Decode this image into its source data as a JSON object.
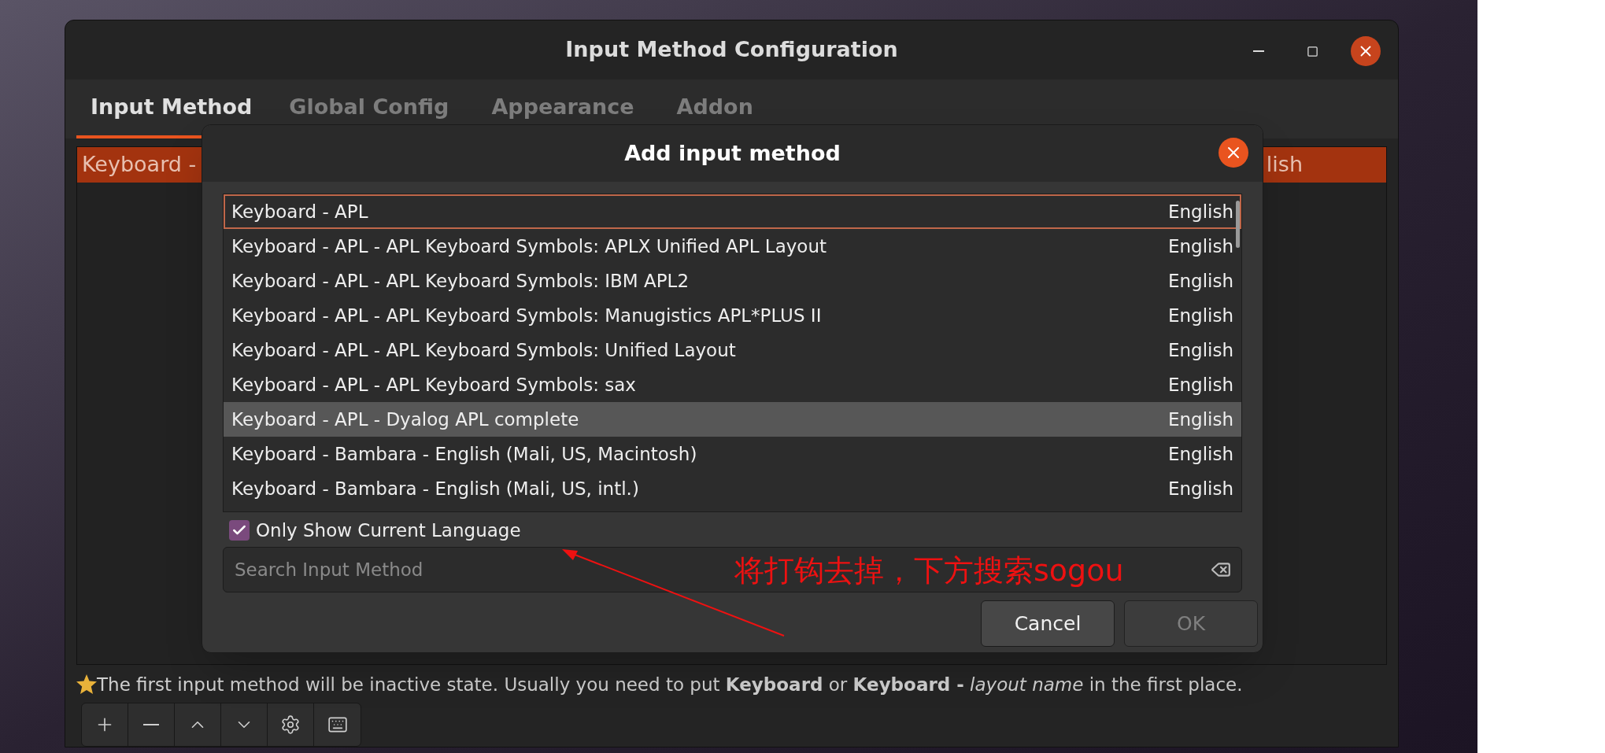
{
  "window": {
    "title": "Input Method Configuration"
  },
  "tabs": [
    {
      "label": "Input Method",
      "selected": true
    },
    {
      "label": "Global Config",
      "selected": false
    },
    {
      "label": "Appearance",
      "selected": false
    },
    {
      "label": "Addon",
      "selected": false
    }
  ],
  "current_list": {
    "rows": [
      {
        "name": "Keyboard -",
        "language": "lish",
        "selected": true
      }
    ]
  },
  "dialog": {
    "title": "Add input method",
    "rows": [
      {
        "name": "Keyboard - APL",
        "language": "English",
        "selected": true,
        "highlighted": false
      },
      {
        "name": "Keyboard - APL - APL Keyboard Symbols: APLX Unified APL Layout",
        "language": "English",
        "selected": false,
        "highlighted": false
      },
      {
        "name": "Keyboard - APL - APL Keyboard Symbols: IBM APL2",
        "language": "English",
        "selected": false,
        "highlighted": false
      },
      {
        "name": "Keyboard - APL - APL Keyboard Symbols: Manugistics APL*PLUS II",
        "language": "English",
        "selected": false,
        "highlighted": false
      },
      {
        "name": "Keyboard - APL - APL Keyboard Symbols: Unified Layout",
        "language": "English",
        "selected": false,
        "highlighted": false
      },
      {
        "name": "Keyboard - APL - APL Keyboard Symbols: sax",
        "language": "English",
        "selected": false,
        "highlighted": false
      },
      {
        "name": "Keyboard - APL - Dyalog APL complete",
        "language": "English",
        "selected": false,
        "highlighted": true
      },
      {
        "name": "Keyboard - Bambara - English (Mali, US, Macintosh)",
        "language": "English",
        "selected": false,
        "highlighted": false
      },
      {
        "name": "Keyboard - Bambara - English (Mali, US, intl.)",
        "language": "English",
        "selected": false,
        "highlighted": false
      }
    ],
    "only_current_language": {
      "label": "Only Show Current Language",
      "checked": true
    },
    "search": {
      "placeholder": "Search Input Method"
    },
    "buttons": [
      {
        "label": "Cancel",
        "disabled": false
      },
      {
        "label": "OK",
        "disabled": true
      }
    ]
  },
  "annotation": {
    "text": "将打钩去掉，下方搜索sogou"
  },
  "hint": "The first input method will be inactive state. Usually you need to put **Keyboard** or **Keyboard -** *layout name* in the first place."
}
